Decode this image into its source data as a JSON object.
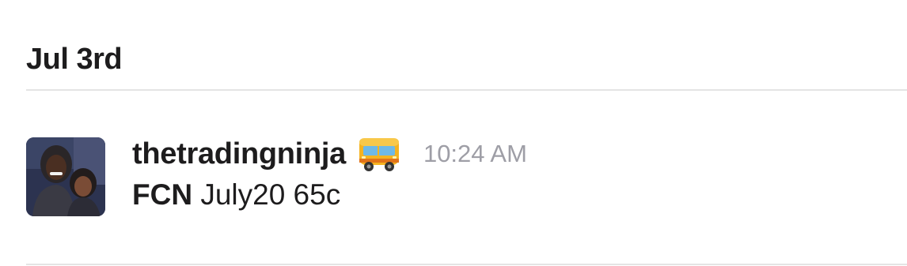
{
  "day_divider": {
    "label": "Jul 3rd"
  },
  "message": {
    "author": "thetradingninja",
    "status_emoji": "bus-icon",
    "timestamp": "10:24 AM",
    "text_bold": "FCN",
    "text_rest": " July20 65c"
  },
  "colors": {
    "text": "#1d1c1d",
    "timestamp": "#9e9ea6",
    "divider": "#e4e4e4",
    "emoji_bus_body": "#f5b320"
  }
}
